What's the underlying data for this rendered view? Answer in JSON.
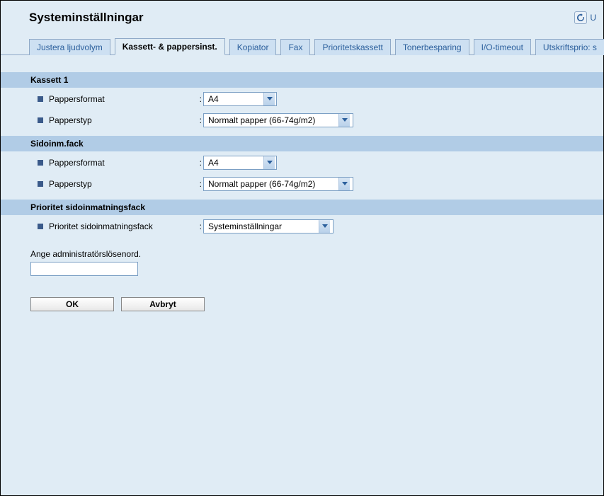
{
  "header": {
    "title": "Systeminställningar",
    "refresh_label": "U"
  },
  "tabs": [
    {
      "label": "Justera ljudvolym",
      "active": false
    },
    {
      "label": "Kassett- & pappersinst.",
      "active": true
    },
    {
      "label": "Kopiator",
      "active": false
    },
    {
      "label": "Fax",
      "active": false
    },
    {
      "label": "Prioritetskassett",
      "active": false
    },
    {
      "label": "Tonerbesparing",
      "active": false
    },
    {
      "label": "I/O-timeout",
      "active": false
    },
    {
      "label": "Utskriftsprio: s",
      "active": false
    }
  ],
  "sections": {
    "cassette1": {
      "title": "Kassett 1",
      "paper_format_label": "Pappersformat",
      "paper_format_value": "A4",
      "paper_type_label": "Papperstyp",
      "paper_type_value": "Normalt papper (66-74g/m2)"
    },
    "bypass": {
      "title": "Sidoinm.fack",
      "paper_format_label": "Pappersformat",
      "paper_format_value": "A4",
      "paper_type_label": "Papperstyp",
      "paper_type_value": "Normalt papper (66-74g/m2)"
    },
    "priority": {
      "title": "Prioritet sidoinmatningsfack",
      "priority_label": "Prioritet sidoinmatningsfack",
      "priority_value": "Systeminställningar"
    }
  },
  "password": {
    "label": "Ange administratörslösenord.",
    "value": ""
  },
  "buttons": {
    "ok": "OK",
    "cancel": "Avbryt"
  }
}
